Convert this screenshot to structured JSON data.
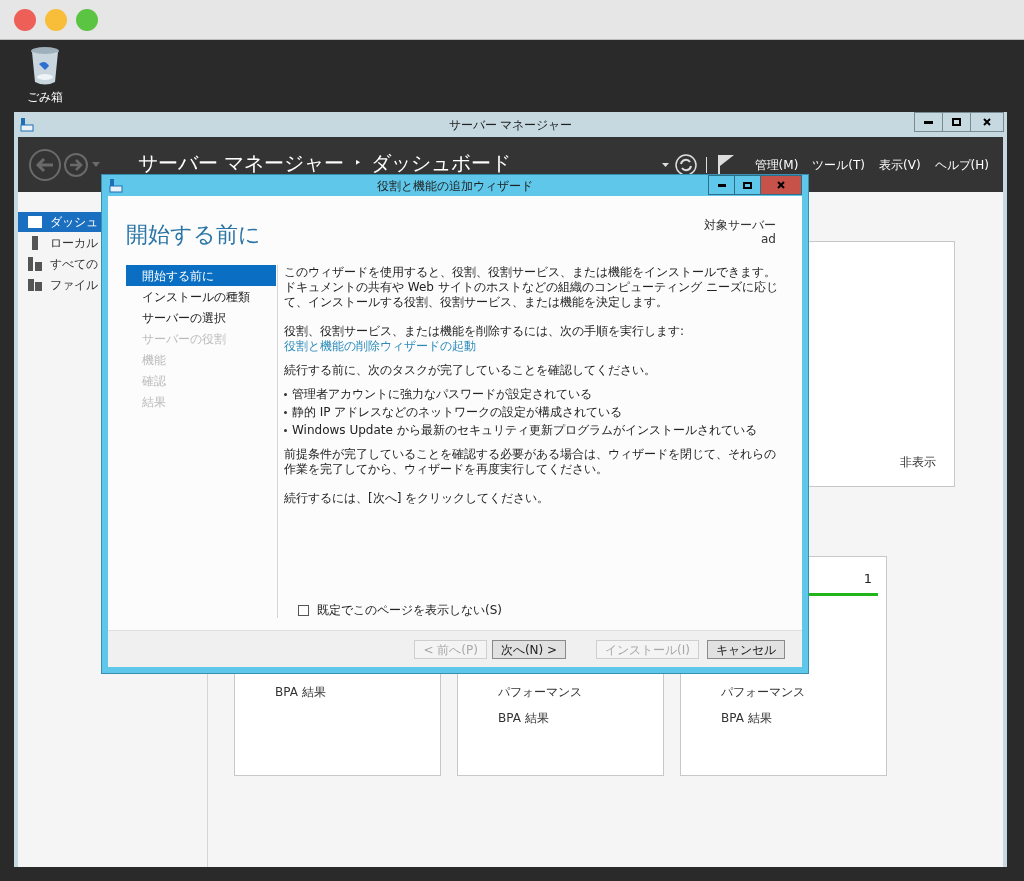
{
  "desktop": {
    "icons": [
      {
        "label": "ごみ箱"
      }
    ]
  },
  "server_manager": {
    "title": "サーバー マネージャー",
    "breadcrumb": {
      "root": "サーバー マネージャー",
      "separator": "‣",
      "page": "ダッシュボード"
    },
    "menus": [
      "管理(M)",
      "ツール(T)",
      "表示(V)",
      "ヘルプ(H)"
    ],
    "sidebar": {
      "items": [
        {
          "label": "ダッシュ",
          "selected": true
        },
        {
          "label": "ローカル",
          "selected": false
        },
        {
          "label": "すべての",
          "selected": false
        },
        {
          "label": "ファイル",
          "selected": false
        }
      ]
    },
    "welcome_card": {
      "hide_link": "非表示"
    },
    "tiles": [
      {
        "items": [
          "BPA 結果"
        ]
      },
      {
        "items": [
          "パフォーマンス",
          "BPA 結果"
        ]
      },
      {
        "count": "1",
        "items": [
          "パフォーマンス",
          "BPA 結果"
        ]
      }
    ]
  },
  "wizard": {
    "title": "役割と機能の追加ウィザード",
    "heading": "開始する前に",
    "target_server": {
      "label": "対象サーバー",
      "value": "ad"
    },
    "steps": [
      {
        "label": "開始する前に",
        "selected": true,
        "disabled": false
      },
      {
        "label": "インストールの種類",
        "selected": false,
        "disabled": false
      },
      {
        "label": "サーバーの選択",
        "selected": false,
        "disabled": false
      },
      {
        "label": "サーバーの役割",
        "selected": false,
        "disabled": true
      },
      {
        "label": "機能",
        "selected": false,
        "disabled": true
      },
      {
        "label": "確認",
        "selected": false,
        "disabled": true
      },
      {
        "label": "結果",
        "selected": false,
        "disabled": true
      }
    ],
    "intro": "このウィザードを使用すると、役割、役割サービス、または機能をインストールできます。ドキュメントの共有や Web サイトのホストなどの組織のコンピューティング ニーズに応じて、インストールする役割、役割サービス、または機能を決定します。",
    "remove_hint": "役割、役割サービス、または機能を削除するには、次の手順を実行します:",
    "remove_link": "役割と機能の削除ウィザードの起動",
    "prereq_intro": "続行する前に、次のタスクが完了していることを確認してください。",
    "prereqs": [
      "管理者アカウントに強力なパスワードが設定されている",
      "静的 IP アドレスなどのネットワークの設定が構成されている",
      "Windows Update から最新のセキュリティ更新プログラムがインストールされている"
    ],
    "prereq_note": "前提条件が完了していることを確認する必要がある場合は、ウィザードを閉じて、それらの作業を完了してから、ウィザードを再度実行してください。",
    "continue_note": "続行するには、[次へ] をクリックしてください。",
    "skip_checkbox": {
      "label": "既定でこのページを表示しない(S)",
      "checked": false
    },
    "buttons": [
      {
        "label": "< 前へ(P)",
        "disabled": true
      },
      {
        "label": "次へ(N) >",
        "disabled": false
      },
      {
        "label": "インストール(I)",
        "disabled": true
      },
      {
        "label": "キャンセル",
        "disabled": false
      }
    ]
  }
}
